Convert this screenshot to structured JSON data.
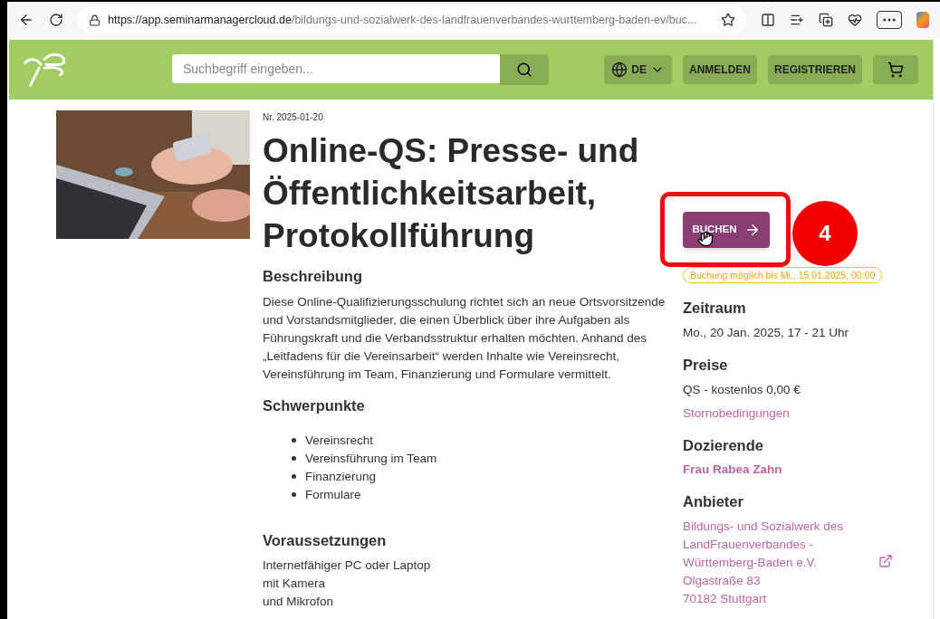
{
  "browser": {
    "url_host": "https://app.seminarmanagercloud.de",
    "url_path": "/bildungs-und-sozialwerk-des-landfrauenverbandes-wurttemberg-baden-ev/buc..."
  },
  "header": {
    "search": {
      "placeholder": "Suchbegriff eingeben..."
    },
    "language": "DE",
    "buttons": [
      "ANMELDEN",
      "REGISTRIEREN"
    ]
  },
  "course": {
    "number": "Nr. 2025-01-20",
    "title": "Online-QS: Presse- und Öffentlichkeitsarbeit, Protokollführung",
    "sections": [
      {
        "heading": "Beschreibung",
        "kind": "paragraph",
        "text": "Diese Online-Qualifizierungsschulung richtet sich an neue Ortsvorsitzende und Vorstandsmitglieder, die einen Überblick über ihre Aufgaben als Führungskraft und die Verbandsstruktur erhalten möchten. Anhand des „Leitfadens für die Vereinsarbeit“ werden Inhalte wie Vereinsrecht, Vereinsführung im Team, Finanzierung und Formulare vermittelt."
      },
      {
        "heading": "Schwerpunkte",
        "kind": "bullets",
        "items": [
          "Vereinsrecht",
          "Vereinsführung im Team",
          "Finanzierung",
          "Formulare"
        ]
      },
      {
        "heading": "Voraussetzungen",
        "kind": "lines",
        "items": [
          "Internetfähiger PC oder Laptop",
          "mit Kamera",
          "und Mikrofon"
        ]
      }
    ]
  },
  "booking": {
    "button": "BUCHEN",
    "deadline": "Buchung möglich bis Mi., 15.01.2025, 00:00",
    "annotation": "4",
    "details": [
      {
        "heading": "Zeitraum",
        "lines": [
          {
            "text": "Mo., 20 Jan. 2025, 17 - 21 Uhr",
            "kind": "plain"
          }
        ]
      },
      {
        "heading": "Preise",
        "lines": [
          {
            "text": "QS - kostenlos 0,00 €",
            "kind": "plain"
          },
          {
            "text": "Stornobedingungen",
            "kind": "link"
          }
        ]
      },
      {
        "heading": "Dozierende",
        "lines": [
          {
            "text": "Frau Rabea Zahn",
            "kind": "strong-link"
          }
        ]
      },
      {
        "heading": "Anbieter",
        "lines": [
          {
            "text": "Bildungs- und Sozialwerk des",
            "kind": "link"
          },
          {
            "text": "LandFrauenverbandes -",
            "kind": "link"
          },
          {
            "text": "Württemberg-Baden e.V.",
            "kind": "link"
          },
          {
            "text": "Olgastraße 83",
            "kind": "link"
          },
          {
            "text": "70182 Stuttgart",
            "kind": "link"
          }
        ],
        "external": true
      }
    ]
  }
}
